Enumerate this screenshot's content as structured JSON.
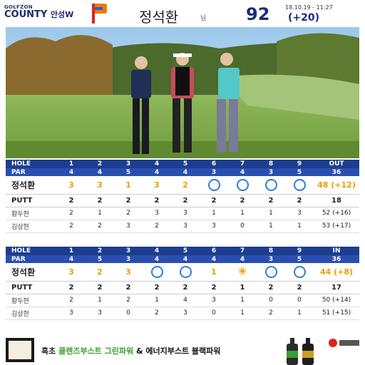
{
  "header": {
    "brand_small": "GOLFZON",
    "brand_name": "COUNTY",
    "brand_suffix": "안성W",
    "player_name": "정석환",
    "honorific": "님",
    "total_score": "92",
    "date_time": "18.10.19 - 11:27",
    "total_diff": "(+20)"
  },
  "colors": {
    "accent": "#1d3d8f",
    "par_row": "#2b4fb0",
    "highlight": "#e8a000",
    "circle": "#2d7ed8"
  },
  "front": {
    "hole_label": "HOLE",
    "holes": [
      "1",
      "2",
      "3",
      "4",
      "5",
      "6",
      "7",
      "8",
      "9"
    ],
    "total_label": "OUT",
    "par_label": "PAR",
    "par": [
      "4",
      "4",
      "5",
      "4",
      "4",
      "3",
      "4",
      "3",
      "5"
    ],
    "par_total": "36",
    "player": {
      "name": "정석환",
      "scores": [
        "3",
        "3",
        "1",
        "3",
        "2",
        "circle",
        "circle",
        "circle",
        "circle"
      ],
      "total": "48 (+12)"
    },
    "putt": {
      "label": "PUTT",
      "values": [
        "2",
        "2",
        "2",
        "2",
        "2",
        "2",
        "2",
        "2",
        "2"
      ],
      "total": "18"
    },
    "others": [
      {
        "name": "황두현",
        "scores": [
          "2",
          "1",
          "2",
          "3",
          "3",
          "1",
          "1",
          "1",
          "3"
        ],
        "total": "52 (+16)"
      },
      {
        "name": "김상현",
        "scores": [
          "2",
          "2",
          "3",
          "2",
          "3",
          "3",
          "0",
          "1",
          "1"
        ],
        "total": "53 (+17)"
      }
    ]
  },
  "back": {
    "hole_label": "HOLE",
    "holes": [
      "1",
      "2",
      "3",
      "4",
      "5",
      "6",
      "7",
      "8",
      "9"
    ],
    "total_label": "IN",
    "par_label": "PAR",
    "par": [
      "4",
      "5",
      "3",
      "4",
      "4",
      "4",
      "4",
      "3",
      "5"
    ],
    "par_total": "36",
    "player": {
      "name": "정석환",
      "scores": [
        "3",
        "2",
        "3",
        "circle",
        "circle",
        "1",
        "ribbon",
        "circle",
        "circle"
      ],
      "total": "44 (+8)"
    },
    "putt": {
      "label": "PUTT",
      "values": [
        "2",
        "2",
        "2",
        "2",
        "2",
        "2",
        "1",
        "2",
        "2"
      ],
      "total": "17"
    },
    "others": [
      {
        "name": "황두현",
        "scores": [
          "2",
          "1",
          "2",
          "1",
          "4",
          "3",
          "1",
          "0",
          "0"
        ],
        "total": "50 (+14)"
      },
      {
        "name": "김상현",
        "scores": [
          "3",
          "3",
          "0",
          "2",
          "3",
          "0",
          "1",
          "2",
          "1"
        ],
        "total": "51 (+15)"
      }
    ]
  },
  "ad": {
    "part1": "흑초 ",
    "part2": "클렌즈부스트 그린파워",
    "part3": " & 에너지부스트 블랙파워"
  }
}
